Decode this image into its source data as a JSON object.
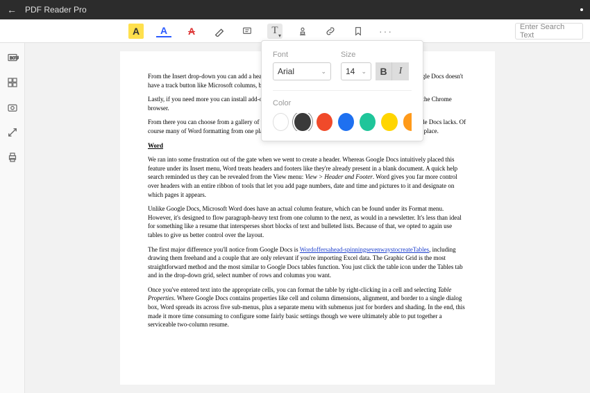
{
  "app": {
    "title": "PDF Reader Pro"
  },
  "toolbar": {
    "search_placeholder": "Enter Search Text",
    "highlight_label": "A",
    "underline_label": "A",
    "strike_label": "A",
    "text_label": "T"
  },
  "popup": {
    "font_label": "Font",
    "size_label": "Size",
    "color_label": "Color",
    "font_value": "Arial",
    "size_value": "14",
    "bold_label": "B",
    "italic_label": "I",
    "colors": [
      "#ffffff",
      "#3a3a3a",
      "#f04a2a",
      "#1e70f0",
      "#1fc59a",
      "#ffd500",
      "#ff9a1a"
    ]
  },
  "doc": {
    "p1": "From the Insert drop-down you can add a header or footer, which is convenient for the table of a resume. Google Docs doesn't have a track button like Microsoft columns, but using tables with hidden borders works.",
    "p2": "Lastly, if you need more you can install add-ons under under that drop-down. To do this, you will need to use the Chrome browser.",
    "p3": "From there you can choose from a gallery of third-party tools that let you do a workarounds for features Google Docs lacks. Of course many of Word formatting from one place. But cumulatively, it works and your color and font from one place.",
    "section": "Word",
    "p4_a": "We ran into some frustration out of the gate when we went to create a header. Whereas Google Docs intuitively placed this feature under its Insert menu, Word treats headers and footers like they're already present in a blank document. A quick help search reminded us they can be revealed from the View menu: ",
    "p4_i": "View > Header and Footer",
    "p4_b": ". Word gives you far more control over headers with an entire ribbon of tools that let you add page numbers, date and time and pictures to it and designate on which pages it appears.",
    "p5": "Unlike Google Docs, Microsoft Word does have an actual column feature, which can be found under its Format menu. However, it's designed to flow paragraph-heavy text from one column to the next, as would in a newsletter. It's less than ideal for something like a resume that intersperses short blocks of text and bulleted lists. Because of that, we opted to again use tables to give us better control over the layout.",
    "p6_a": "The first major difference you'll notice from Google Docs is ",
    "p6_l1": "Wordoffersahead-spinningsevenwaystocreateTables",
    "p6_b": ", including drawing them freehand and a couple that are only relevant if you're importing Excel data. The Graphic Grid is the most straightforward method and the most similar to Google Docs tables function. You just click the table icon under the Tables tab and in the drop-down grid, select number of rows and columns you want.",
    "p7_a": "Once you've entered text into the appropriate cells, you can format the table by right-clicking in a cell and selecting ",
    "p7_i": "Table Properties",
    "p7_b": ". Where Google Docs contains properties like cell and column dimensions, alignment, and border to a single dialog box, Word spreads its across five sub-menus, plus a separate menu with submenus just for borders and shading. In the end, this made it more time consuming to configure some fairly basic settings though we were ultimately able to put together a serviceable two-column resume."
  }
}
